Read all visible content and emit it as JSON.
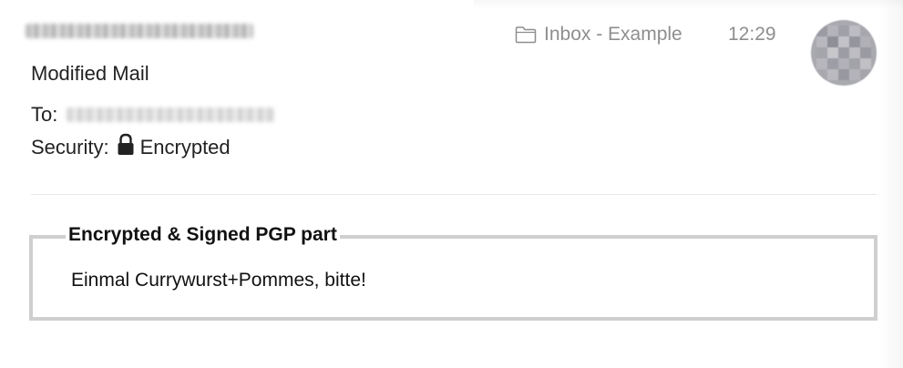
{
  "header": {
    "sender_redacted": true,
    "mailbox": "Inbox - Example",
    "time": "12:29",
    "folder_icon": "folder-icon",
    "avatar_redacted": true
  },
  "message": {
    "subject": "Modified Mail",
    "to_label": "To:",
    "to_redacted": true,
    "security_label": "Security:",
    "security_icon": "lock-icon",
    "security_value": "Encrypted"
  },
  "pgp_part": {
    "legend": "Encrypted & Signed PGP part",
    "body": "Einmal Currywurst+Pommes, bitte!"
  }
}
